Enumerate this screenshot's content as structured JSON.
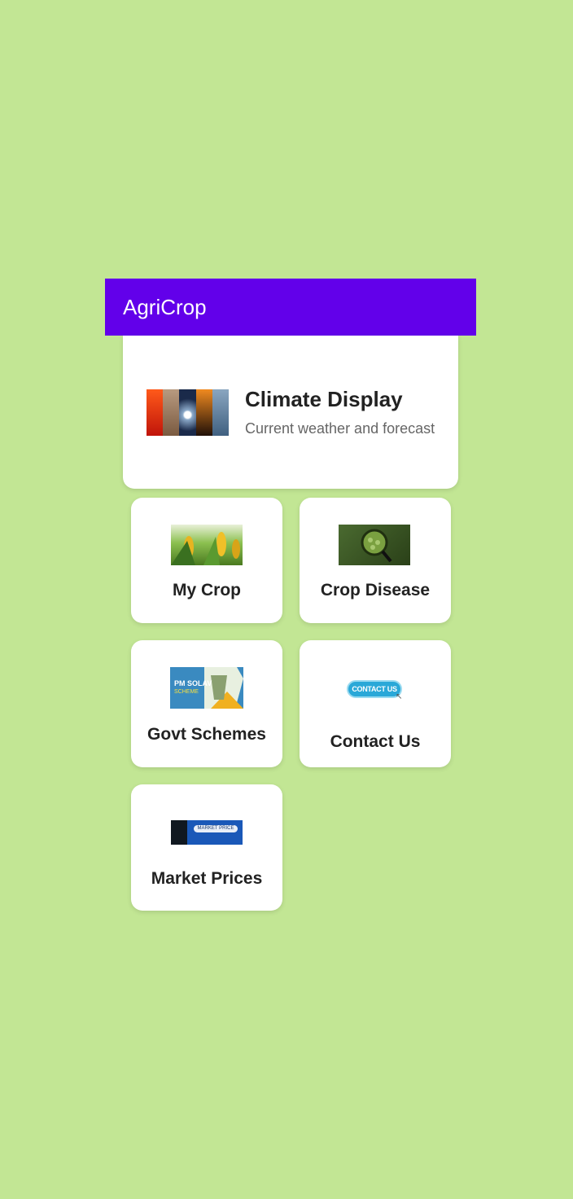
{
  "app": {
    "title": "AgriCrop"
  },
  "climate": {
    "title": "Climate Display",
    "subtitle": "Current weather and forecast"
  },
  "tiles": {
    "my_crop": {
      "label": "My Crop"
    },
    "crop_disease": {
      "label": "Crop Disease"
    },
    "govt_schemes": {
      "label": "Govt Schemes",
      "image_text_1": "PM SOLAV",
      "image_text_2": "SCHEME"
    },
    "contact_us": {
      "label": "Contact Us",
      "badge_text": "CONTACT US"
    },
    "market_prices": {
      "label": "Market Prices",
      "image_text": "MARKET PRICE"
    }
  },
  "colors": {
    "background": "#c2e694",
    "app_bar": "#6200ea",
    "card": "#ffffff"
  }
}
